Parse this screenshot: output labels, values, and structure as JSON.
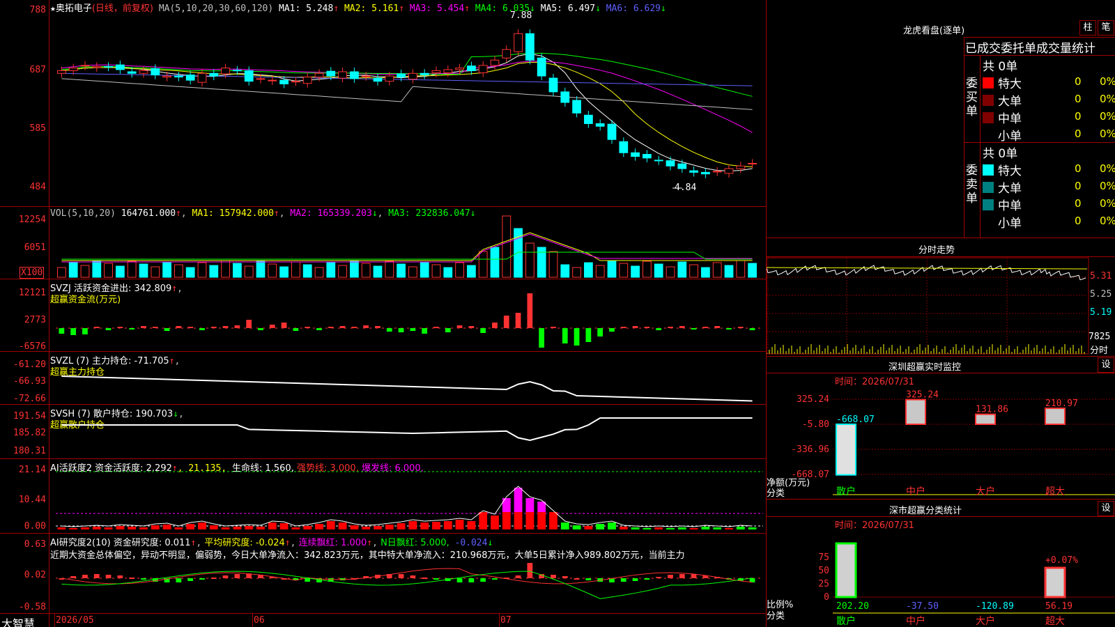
{
  "header": {
    "star": "★",
    "stock_name": "奥拓电子",
    "period": "(日线，前复权)",
    "ma_def": "MA(5,10,20,30,60,120)",
    "ma1": "MA1: 5.248",
    "ma2": "MA2: 5.161",
    "ma3": "MA3: 5.454",
    "ma4": "MA4: 6.035",
    "ma5": "MA5: 6.497",
    "ma6": "MA6: 6.629",
    "up": "↑",
    "down": "↓"
  },
  "main_chart": {
    "y_ticks": [
      "788",
      "687",
      "585",
      "484"
    ],
    "high_label": "7.88",
    "low_label": "4.84"
  },
  "vol_panel": {
    "title": "VOL(5,10,20)",
    "value": "164761.000",
    "ma1": "MA1: 157942.000",
    "ma2": "MA2: 165339.203",
    "ma3": "MA3: 232836.047",
    "y_ticks": [
      "12254",
      "6051"
    ],
    "unit": "X100"
  },
  "svzj_panel": {
    "title": "SVZJ  活跃资金进出: 342.809",
    "subtitle": "超赢资金流(万元)",
    "y_ticks": [
      "12121",
      "2773",
      "-6576"
    ]
  },
  "svzl_panel": {
    "title": "SVZL (7) 主力持仓: -71.705",
    "subtitle": "超赢主力持仓",
    "y_ticks": [
      "-61.20",
      "-66.93",
      "-72.66"
    ]
  },
  "svsh_panel": {
    "title": "SVSH (7) 散户持仓: 190.703",
    "subtitle": "超赢散户持仓",
    "y_ticks": [
      "191.54",
      "185.82",
      "180.31"
    ]
  },
  "ai_active_panel": {
    "title": "AI活跃度2 资金活跃度: 2.292",
    "v2": ", 21.135, ",
    "life": "生命线: 1.560,",
    "strong": " 强势线: 3.000,",
    "burst": " 爆发线: 6.000,",
    "y_ticks": [
      "21.14",
      "10.44",
      "0.00"
    ]
  },
  "ai_research_panel": {
    "title": "AI研究度2(10) 资金研究度: 0.011",
    "avg": " 平均研究度: -0.024",
    "cont": " 连续飘红: 1.000",
    "nday": " N日飘红: 5.000,",
    "neg": " -0.024",
    "desc": "近期大资金总体偏空，异动不明显，偏弱势，今日大单净流入：342.823万元，其中特大单净流入：210.968万元，大单5日累计净入989.802万元，当前主力",
    "y_ticks": [
      "0.63",
      "0.02",
      "-0.58"
    ]
  },
  "x_axis": {
    "labels": [
      "2026/05",
      "06",
      "07"
    ],
    "brand": "大智慧"
  },
  "right_panel": {
    "dragon_title": "龙虎看盘(逐单)",
    "btn_zhu": "柱",
    "btn_bi": "笔",
    "order_stats_title": "已成交委托单成交量统计",
    "buy_label": "委买单",
    "sell_label": "委卖单",
    "total_buy": "共 0单",
    "total_sell": "共 0单",
    "rows": [
      "特大",
      "大单",
      "中单",
      "小单"
    ],
    "zero": "0",
    "pct": "0%",
    "intraday_title": "分时走势",
    "intraday_prices": [
      "5.31",
      "5.25",
      "5.19"
    ],
    "intraday_vol": "7825",
    "intraday_label": "分时",
    "sz_monitor_title": "深圳超赢实时监控",
    "set_btn": "设",
    "date_label": "时间：2026/07/31",
    "net_label": "净额(万元)",
    "class_label": "分类",
    "categories": [
      "散户",
      "中户",
      "大户",
      "超大"
    ],
    "net_values": [
      -668.07,
      325.24,
      131.86,
      210.97
    ],
    "net_value_labels": [
      "-668.07",
      "325.24",
      "131.86",
      "210.97"
    ],
    "net_ticks": [
      "325.24",
      "-5.80",
      "-336.96",
      "-668.07"
    ],
    "sz_stat_title": "深市超赢分类统计",
    "ratio_label": "比例%",
    "ratio_ticks": [
      "75",
      "50",
      "25",
      "0"
    ],
    "ratio_values": [
      "202.20",
      "-37.50",
      "-120.89",
      "56.19"
    ],
    "ratio_note": "+0.07%"
  },
  "chart_data": {
    "type": "candlestick",
    "ylim": [
      4.84,
      7.88
    ],
    "candles_close": [
      6.9,
      6.95,
      7.0,
      6.98,
      6.97,
      6.92,
      6.85,
      6.9,
      6.82,
      6.8,
      6.78,
      6.72,
      6.85,
      6.8,
      6.95,
      6.9,
      6.7,
      6.75,
      6.72,
      6.65,
      6.7,
      6.78,
      6.85,
      6.8,
      6.88,
      6.75,
      6.8,
      6.7,
      6.8,
      6.78,
      6.85,
      6.82,
      6.9,
      6.92,
      6.95,
      6.9,
      7.0,
      7.1,
      7.3,
      7.6,
      7.1,
      6.8,
      6.5,
      6.3,
      6.1,
      5.9,
      5.85,
      5.6,
      5.35,
      5.28,
      5.25,
      5.2,
      5.1,
      5.05,
      4.98,
      4.95,
      5.0,
      5.05,
      5.1,
      5.15,
      5.2,
      5.25
    ]
  }
}
